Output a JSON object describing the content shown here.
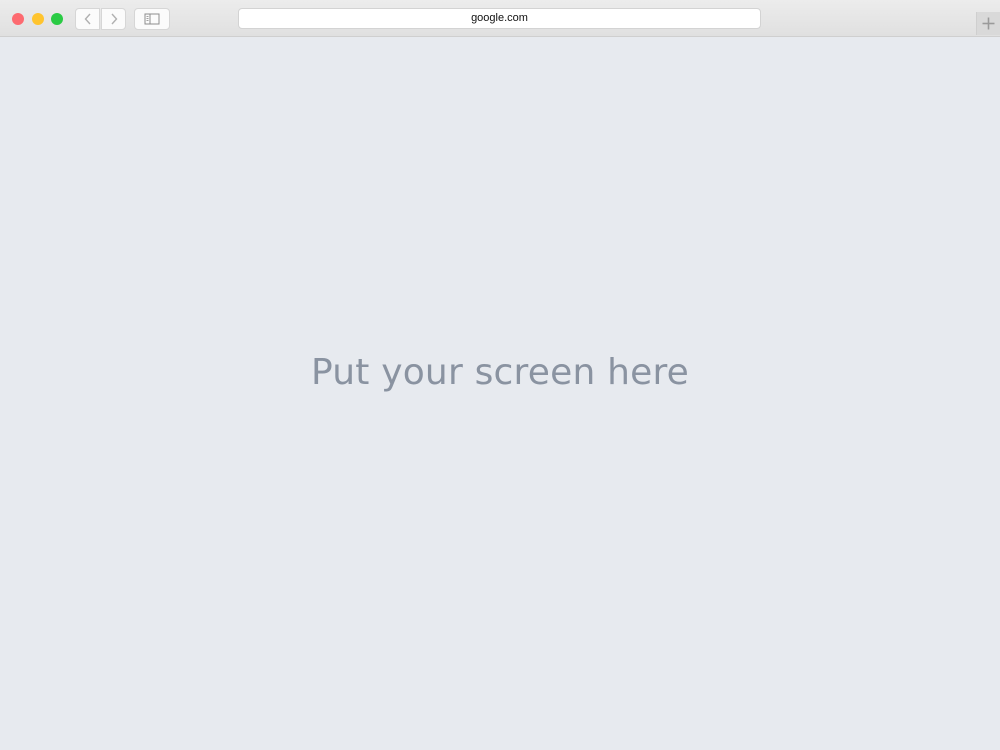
{
  "window": {
    "controls": {
      "close_color": "#fd6a70",
      "minimize_color": "#ffc42e",
      "maximize_color": "#2acb44"
    }
  },
  "toolbar": {
    "back_icon": "chevron-left-icon",
    "forward_icon": "chevron-right-icon",
    "sidebar_icon": "sidebar-icon",
    "new_tab_icon": "plus-icon"
  },
  "address_bar": {
    "url": "google.com"
  },
  "content": {
    "placeholder": "Put your screen here",
    "background_color": "#e7eaef",
    "text_color": "#8a93a1"
  }
}
